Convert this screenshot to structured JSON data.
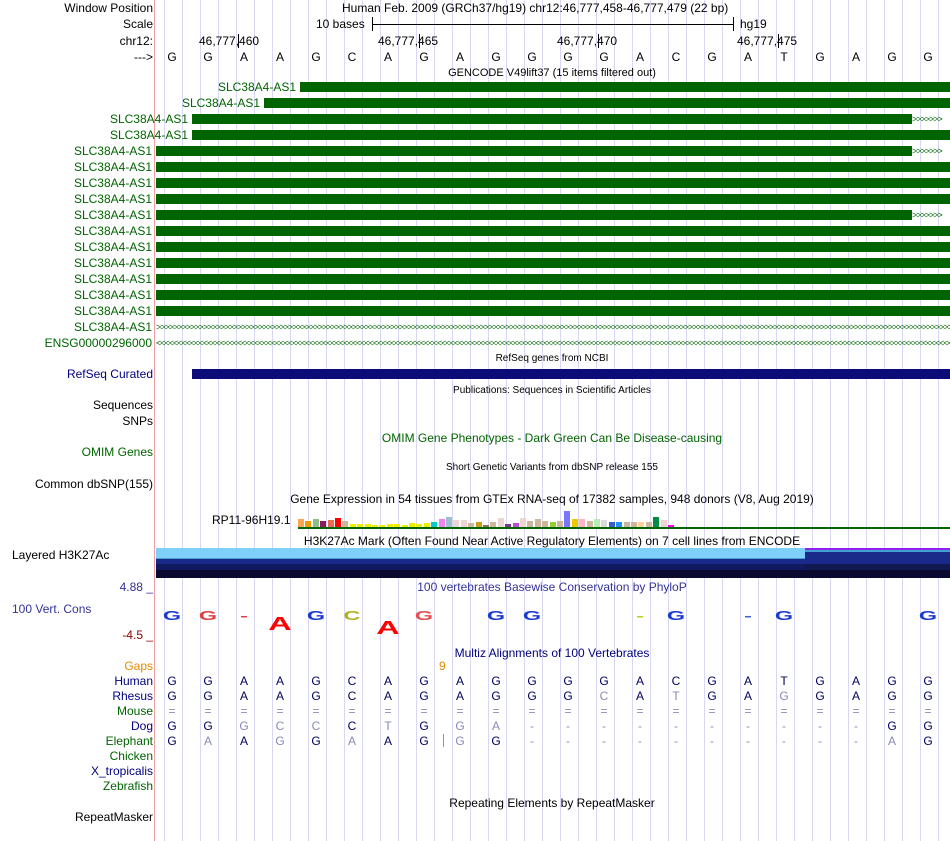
{
  "header": {
    "window_position_label": "Window Position",
    "window_position": "Human Feb. 2009 (GRCh37/hg19)   chr12:46,777,458-46,777,479 (22 bp)",
    "scale_label": "Scale",
    "scale_text": "10 bases",
    "scale_assembly": "hg19",
    "chrom_label": "chr12:",
    "ticks": [
      "46,777,460",
      "46,777,465",
      "46,777,470",
      "46,777,475"
    ],
    "strand_label": "--->",
    "sequence": [
      "G",
      "G",
      "A",
      "A",
      "G",
      "C",
      "A",
      "G",
      "A",
      "G",
      "G",
      "G",
      "G",
      "A",
      "C",
      "G",
      "A",
      "T",
      "G",
      "A",
      "G",
      "G"
    ]
  },
  "gencode": {
    "title": "GENCODE V49lift37 (15 items filtered out)",
    "rows": [
      "SLC38A4-AS1",
      "SLC38A4-AS1",
      "SLC38A4-AS1",
      "SLC38A4-AS1",
      "SLC38A4-AS1",
      "SLC38A4-AS1",
      "SLC38A4-AS1",
      "SLC38A4-AS1",
      "SLC38A4-AS1",
      "SLC38A4-AS1",
      "SLC38A4-AS1",
      "SLC38A4-AS1",
      "SLC38A4-AS1",
      "SLC38A4-AS1",
      "SLC38A4-AS1",
      "SLC38A4-AS1",
      "ENSG00000296000"
    ]
  },
  "refseq": {
    "title": "RefSeq genes from NCBI",
    "label": "RefSeq Curated"
  },
  "publications": {
    "title": "Publications: Sequences in Scientific Articles",
    "sequences_label": "Sequences",
    "snps_label": "SNPs"
  },
  "omim": {
    "title": "OMIM Gene Phenotypes - Dark Green Can Be Disease-causing",
    "label": "OMIM Genes"
  },
  "dbsnp": {
    "title": "Short Genetic Variants from dbSNP release 155",
    "label": "Common dbSNP(155)"
  },
  "gtex": {
    "title": "Gene Expression in 54 tissues from GTEx RNA-seq of 17382 samples, 948 donors (V8, Aug 2019)",
    "gene": "RP11-96H19.1",
    "colors": [
      "#ffa54f",
      "#ee9a00",
      "#8fbc8f",
      "#8b1c62",
      "#ee6a50",
      "#ff0000",
      "#cdb79e",
      "#eeee00",
      "#eeee00",
      "#eeee00",
      "#eeee00",
      "#eeee00",
      "#eeee00",
      "#eeee00",
      "#eeee00",
      "#eeee00",
      "#eeee00",
      "#eeee00",
      "#00cdcd",
      "#ee82ee",
      "#9ac0cd",
      "#eed5d2",
      "#eed5d2",
      "#cdb79e",
      "#cd9b1d",
      "#8b7355",
      "#cdb79e",
      "#eed5d2",
      "#7a378b",
      "#b452cd",
      "#eed5d2",
      "#cdb79e",
      "#cdb79e",
      "#cdb79e",
      "#9acd32",
      "#cdb79e",
      "#7777ff",
      "#eec900",
      "#ffb6c1",
      "#cdb79e",
      "#b4eeb4",
      "#d9d9d9",
      "#3a5fcd",
      "#1e90ff",
      "#cdb79e",
      "#cdb79e",
      "#ffd39b",
      "#cdb79e",
      "#008b45",
      "#eed5d2",
      "#ff00ff"
    ],
    "values": [
      4,
      3,
      4,
      3,
      3.5,
      4.5,
      3,
      1.5,
      1.5,
      1.5,
      1,
      1.2,
      1.5,
      1.5,
      1.2,
      2,
      1.5,
      2,
      2.5,
      4,
      5,
      3.5,
      3.5,
      2,
      2.5,
      1.2,
      2.5,
      4.5,
      1.5,
      2,
      4.5,
      3,
      4,
      3,
      2.5,
      3,
      8,
      4,
      4,
      3,
      4,
      3.5,
      2.5,
      2.5,
      2.5,
      2.5,
      2.5,
      2.5,
      5,
      3.5,
      1
    ]
  },
  "h3k27ac": {
    "title": "H3K27Ac Mark (Often Found Near Active Regulatory Elements) on 7 cell lines from ENCODE",
    "label": "Layered H3K27Ac"
  },
  "phylop": {
    "title": "100 vertebrates Basewise Conservation by PhyloP",
    "label": "100 Vert. Cons",
    "max": "4.88 _",
    "min": "-4.5 _"
  },
  "multiz": {
    "title": "Multiz Alignments of 100 Vertebrates",
    "gaps_label": "Gaps",
    "gap_value": "9",
    "species": [
      {
        "name": "Human",
        "color": "#000080",
        "seq": "GGAAGCAGAGGGGACGATGAGG",
        "mm": "0000000000000000000000"
      },
      {
        "name": "Rhesus",
        "color": "#000080",
        "seq": "GGAAGCAGAGGGCATGAGGAGG",
        "mm": "0000000000001010010000"
      },
      {
        "name": "Mouse",
        "color": "#006400",
        "seq": "======================",
        "mm": "1111111111111111111111"
      },
      {
        "name": "Dog",
        "color": "#000080",
        "seq": "GGGCCCTGGA----------GG",
        "mm": "0011101011----------00"
      },
      {
        "name": "Elephant",
        "color": "#006400",
        "seq": "GAAGGAAGGG----------AG",
        "mm": "0101010010----------10"
      },
      {
        "name": "Chicken",
        "color": "#006400",
        "seq": "",
        "mm": ""
      },
      {
        "name": "X_tropicalis",
        "color": "#000080",
        "seq": "",
        "mm": ""
      },
      {
        "name": "Zebrafish",
        "color": "#006400",
        "seq": "",
        "mm": ""
      }
    ]
  },
  "repeatmasker": {
    "title": "Repeating Elements by RepeatMasker",
    "label": "RepeatMasker"
  }
}
